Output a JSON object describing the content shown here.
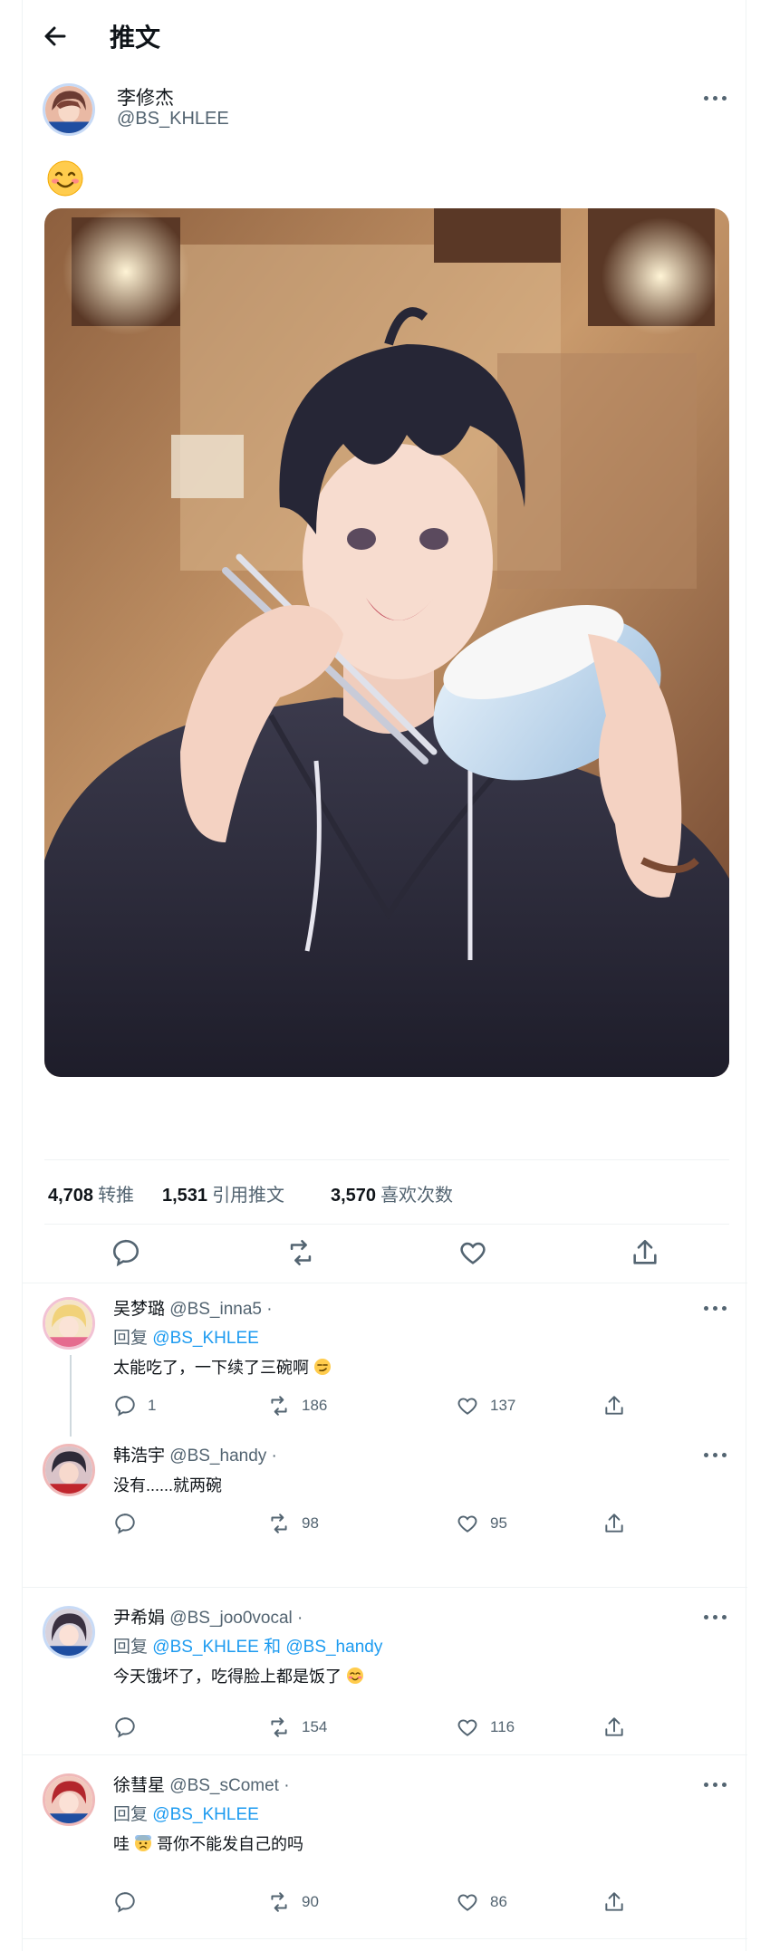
{
  "header": {
    "title": "推文"
  },
  "tweet": {
    "name": "李修杰",
    "handle": "@BS_KHLEE",
    "emoji_icon": "smiling-face-icon",
    "stats": {
      "retweets": "4,708",
      "retweets_label": "转推",
      "quotes": "1,531",
      "quotes_label": "引用推文",
      "likes": "3,570",
      "likes_label": "喜欢次数"
    },
    "colors": {
      "link": "#1d9bf0",
      "secondary_text": "#536471"
    }
  },
  "replies": [
    {
      "name": "吴梦璐",
      "handle": "@BS_inna5 ·",
      "reply_prefix": "回复",
      "reply_to": "@BS_KHLEE",
      "text": "太能吃了，一下续了三碗啊",
      "replies": "1",
      "retweets": "186",
      "likes": "137"
    },
    {
      "name": "韩浩宇",
      "handle": "@BS_handy ·",
      "text": "没有......就两碗",
      "replies": "",
      "retweets": "98",
      "likes": "95"
    },
    {
      "name": "尹希娟",
      "handle": "@BS_joo0vocal ·",
      "reply_prefix": "回复",
      "reply_to": "@BS_KHLEE 和 @BS_handy",
      "text": "今天饿坏了，吃得脸上都是饭了",
      "replies": "",
      "retweets": "154",
      "likes": "116"
    },
    {
      "name": "徐彗星",
      "handle": "@BS_sComet ·",
      "reply_prefix": "回复",
      "reply_to": "@BS_KHLEE",
      "text_a": "哇",
      "text_b": "哥你不能发自己的吗",
      "replies": "",
      "retweets": "90",
      "likes": "86"
    }
  ]
}
